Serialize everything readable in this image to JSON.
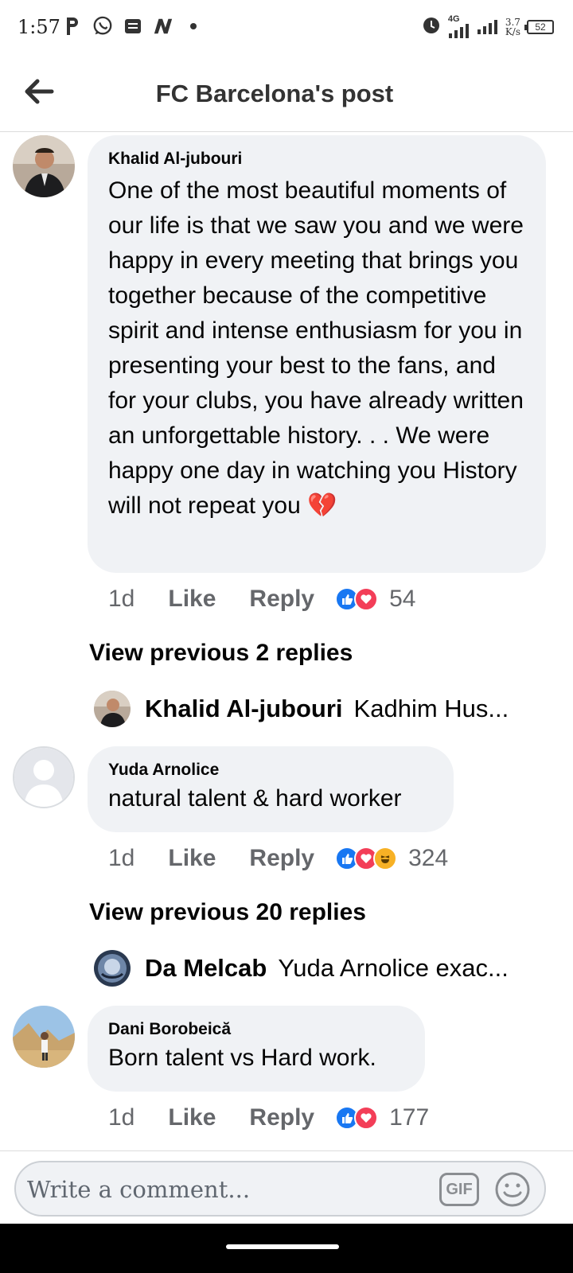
{
  "status_bar": {
    "time": "1:57",
    "left_icons": [
      "parking-icon",
      "whatsapp-icon",
      "message-icon",
      "n-app-icon",
      "dot-icon"
    ],
    "net_speed_value": "3.7",
    "net_speed_unit": "K/s",
    "network": "4G",
    "battery": "52"
  },
  "header": {
    "title": "FC Barcelona's post"
  },
  "comments": [
    {
      "author": "Khalid Al-jubouri",
      "text": "One of the most beautiful moments of our life is that we saw you and we were happy in every meeting that brings you together because of the competitive spirit and intense enthusiasm for you in presenting your best to the fans, and for your clubs, you have already written an unforgettable history.  .  .  We were happy one day in watching you  History will not repeat you 💔",
      "age": "1d",
      "like_label": "Like",
      "reply_label": "Reply",
      "reactions": [
        "like",
        "love"
      ],
      "reaction_count": "54",
      "view_previous": "View previous 2 replies",
      "reply_preview": {
        "name": "Khalid Al-jubouri",
        "text": "Kadhim Hus..."
      }
    },
    {
      "author": "Yuda Arnolice",
      "text": "natural talent & hard worker",
      "age": "1d",
      "like_label": "Like",
      "reply_label": "Reply",
      "reactions": [
        "like",
        "love",
        "haha"
      ],
      "reaction_count": "324",
      "view_previous": "View previous 20 replies",
      "reply_preview": {
        "name": "Da Melcab",
        "text": "Yuda Arnolice exac..."
      }
    },
    {
      "author": "Dani Borobeică",
      "text": "Born talent vs Hard work.",
      "age": "1d",
      "like_label": "Like",
      "reply_label": "Reply",
      "reactions": [
        "like",
        "love"
      ],
      "reaction_count": "177"
    }
  ],
  "composer": {
    "placeholder": "Write a comment...",
    "gif_label": "GIF"
  },
  "colors": {
    "like_blue": "#1877f2",
    "love_red": "#f33e58",
    "haha_yellow": "#f7b125",
    "bubble_bg": "#f0f2f5",
    "meta_gray": "#65676b"
  }
}
